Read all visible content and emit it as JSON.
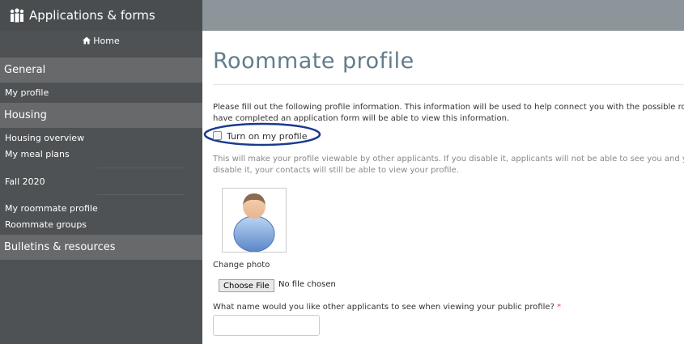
{
  "brand": {
    "title": "Applications & forms",
    "icon": "people-icon"
  },
  "sidebar": {
    "home_label": "Home",
    "sections": [
      {
        "label": "General",
        "items": [
          "My profile"
        ]
      },
      {
        "label": "Housing",
        "items": [
          "Housing overview",
          "My meal plans",
          "Fall 2020",
          "My roommate profile",
          "Roommate groups"
        ]
      },
      {
        "label": "Bulletins & resources",
        "items": []
      }
    ]
  },
  "main": {
    "title": "Roommate profile",
    "intro_line1": "Please fill out the following profile information. This information will be used to help connect you with the possible roo",
    "intro_line2": "have completed an application form will be able to view this information.",
    "checkbox_label": "Turn on my profile",
    "help_line1": "This will make your profile viewable by other applicants. If you disable it, applicants will not be able to see you and you",
    "help_line2": "disable it, your contacts will still be able to view your profile.",
    "change_photo_label": "Change photo",
    "file_button_label": "Choose File",
    "file_status": "No file chosen",
    "name_question": "What name would you like other applicants to see when viewing your public profile?",
    "required_mark": "*",
    "name_value": ""
  },
  "colors": {
    "sidebar_bg": "#4f5254",
    "section_bg": "#67696b",
    "title": "#607d8b",
    "annotation": "#1a3a8c",
    "required": "#d9534f"
  }
}
